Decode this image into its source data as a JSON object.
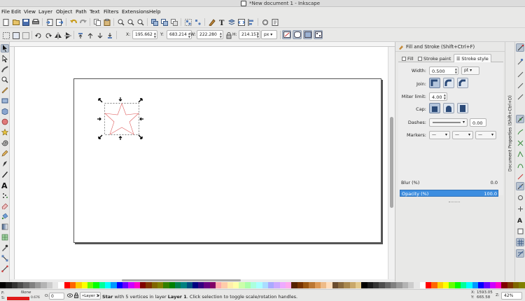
{
  "window": {
    "title": "*New document 1 - Inkscape"
  },
  "menu": [
    "File",
    "Edit",
    "View",
    "Layer",
    "Object",
    "Path",
    "Text",
    "Filters",
    "Extensions",
    "Help"
  ],
  "commands_bar": {
    "icons": [
      "new-document-icon",
      "open-icon",
      "save-icon",
      "print-icon",
      "import-icon",
      "export-icon",
      "undo-icon",
      "redo-icon",
      "copy-icon",
      "paste-icon",
      "zoom-selection-icon",
      "zoom-drawing-icon",
      "zoom-page-icon",
      "duplicate-icon",
      "clone-icon",
      "unlink-clone-icon",
      "group-icon",
      "ungroup-icon",
      "fill-stroke-icon",
      "text-font-icon",
      "layers-icon",
      "xml-editor-icon",
      "align-distribute-icon",
      "preferences-icon",
      "document-properties-icon"
    ]
  },
  "selector_bar": {
    "x_label": "X:",
    "x_value": "195.662",
    "y_label": "Y:",
    "y_value": "683.214",
    "w_label": "W:",
    "w_value": "222.280",
    "h_label": "H:",
    "h_value": "214.157",
    "unit": "px"
  },
  "dock": {
    "title": "Fill and Stroke (Shift+Ctrl+F)",
    "tabs": [
      {
        "label": "Fill",
        "active": false
      },
      {
        "label": "Stroke paint",
        "active": false
      },
      {
        "label": "Stroke style",
        "active": true
      }
    ],
    "stroke_style": {
      "width_label": "Width:",
      "width_value": "0.500",
      "width_unit": "pt",
      "join_label": "Join:",
      "miter_label": "Miter limit:",
      "miter_value": "4.00",
      "cap_label": "Cap:",
      "dashes_label": "Dashes:",
      "dashes_offset": "0.00",
      "markers_label": "Markers:"
    },
    "blur_label": "Blur (%)",
    "blur_value": "0.0",
    "opacity_label": "Opacity (%)",
    "opacity_value": "100.0"
  },
  "side_tab": {
    "label": "Document Properties (Shift+Ctrl+D)"
  },
  "status": {
    "fill_label": "F:",
    "fill_value": "None",
    "stroke_label": "S:",
    "stroke_width": "0.676",
    "opacity_label": "O:",
    "opacity_value": "0",
    "layer": "•Layer 1",
    "message_bold1": "Star",
    "message_mid": " with 5 vertices in layer ",
    "message_bold2": "Layer 1",
    "message_tail": ". Click selection to toggle scale/rotation handles.",
    "cursor_x_label": "X:",
    "cursor_x": "1593.05",
    "cursor_y_label": "Y:",
    "cursor_y": "665.58",
    "zoom_label": "Z:",
    "zoom": "42%"
  },
  "colors": {
    "accent": "#3d8ee0",
    "selected_stroke": "#e06060"
  }
}
